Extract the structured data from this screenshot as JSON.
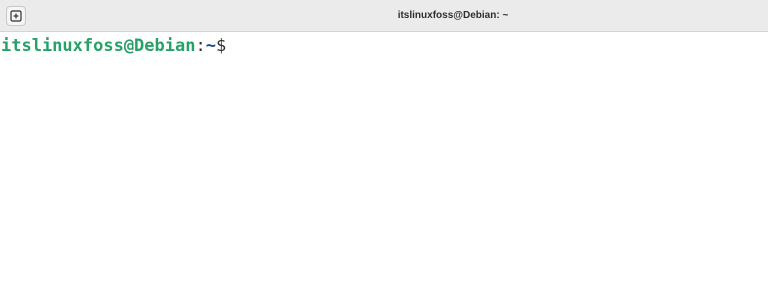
{
  "window": {
    "title": "itslinuxfoss@Debian: ~"
  },
  "toolbar": {
    "new_tab_icon": "new-tab-plus-icon"
  },
  "terminal": {
    "prompt": {
      "user_host": "itslinuxfoss@Debian",
      "separator": ":",
      "path": "~",
      "symbol": "$"
    },
    "colors": {
      "user_host": "#26a269",
      "path": "#12488b",
      "text": "#2e2e2e",
      "background": "#ffffff"
    }
  }
}
